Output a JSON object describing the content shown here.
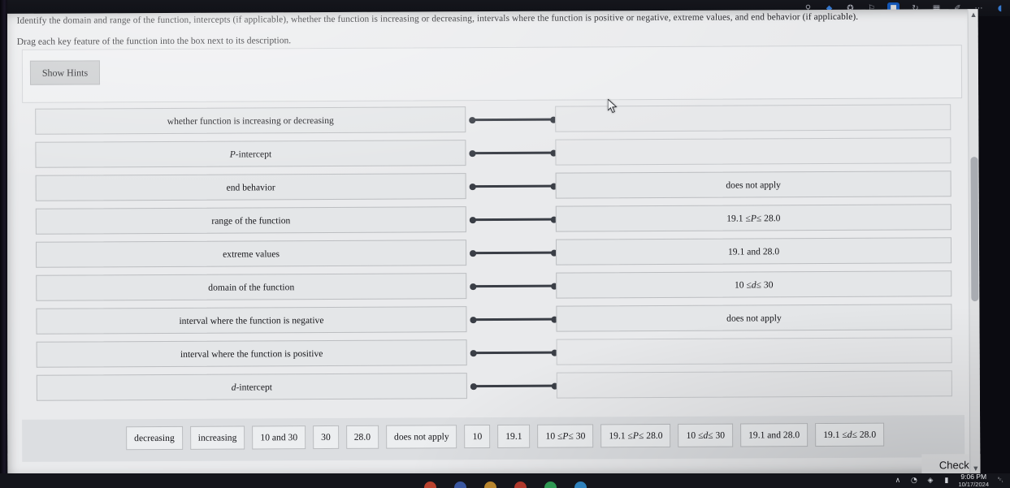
{
  "instructions": {
    "prompt": "Identify the domain and range of the function, intercepts (if applicable), whether the function is increasing or decreasing, intervals where the function is positive or negative, extreme values, and end behavior (if applicable).",
    "drag_instruction": "Drag each key feature of the function into the box next to its description."
  },
  "hints": {
    "button_label": "Show Hints"
  },
  "rows": [
    {
      "label": "whether function is increasing or decreasing",
      "answer": ""
    },
    {
      "label": "P-intercept",
      "answer": ""
    },
    {
      "label": "end behavior",
      "answer": "does not apply"
    },
    {
      "label": "range of the function",
      "answer": "19.1 ≤ P ≤ 28.0"
    },
    {
      "label": "extreme values",
      "answer": "19.1 and 28.0"
    },
    {
      "label": "domain of the function",
      "answer": "10 ≤ d ≤ 30"
    },
    {
      "label": "interval where the function is negative",
      "answer": "does not apply"
    },
    {
      "label": "interval where the function is positive",
      "answer": ""
    },
    {
      "label": "d-intercept",
      "answer": ""
    }
  ],
  "tray": {
    "tiles": [
      "decreasing",
      "increasing",
      "10 and 30",
      "30",
      "28.0",
      "does not apply",
      "10",
      "19.1",
      "10 ≤ P ≤ 30",
      "19.1 ≤ P ≤ 28.0",
      "10 ≤ d ≤ 30",
      "19.1 and 28.0",
      "19.1 ≤ d ≤ 28.0"
    ]
  },
  "actions": {
    "check_label": "Check"
  },
  "scrollbar": {
    "up_glyph": "▲",
    "down_glyph": "▼"
  },
  "taskbar": {
    "clock_time": "9:06 PM",
    "clock_date": "10/17/2024",
    "chevron_glyph": "∧",
    "wifi_glyph": "◔",
    "volume_glyph": "◈",
    "battery_glyph": "▮",
    "bell_glyph": "␇",
    "app_colors": [
      "#c2452f",
      "#3b5aa8",
      "#c08a2e",
      "#b63a2c",
      "#2f9e55",
      "#2f86c4"
    ]
  },
  "browser_chrome": {
    "icon_glyphs": [
      "⌕",
      "▼",
      "✦",
      "⚐",
      "▣",
      "↻",
      "▦",
      "✐",
      "⋯",
      "◖"
    ],
    "badge_glyph": "■"
  },
  "colors": {
    "page_bg": "#e9eaec",
    "box_bg": "#e4e6e8",
    "box_border": "#bcbec1",
    "connector": "#3a3e46",
    "tray_bg": "#dcdee1",
    "hint_btn": "#c9cbcd"
  }
}
